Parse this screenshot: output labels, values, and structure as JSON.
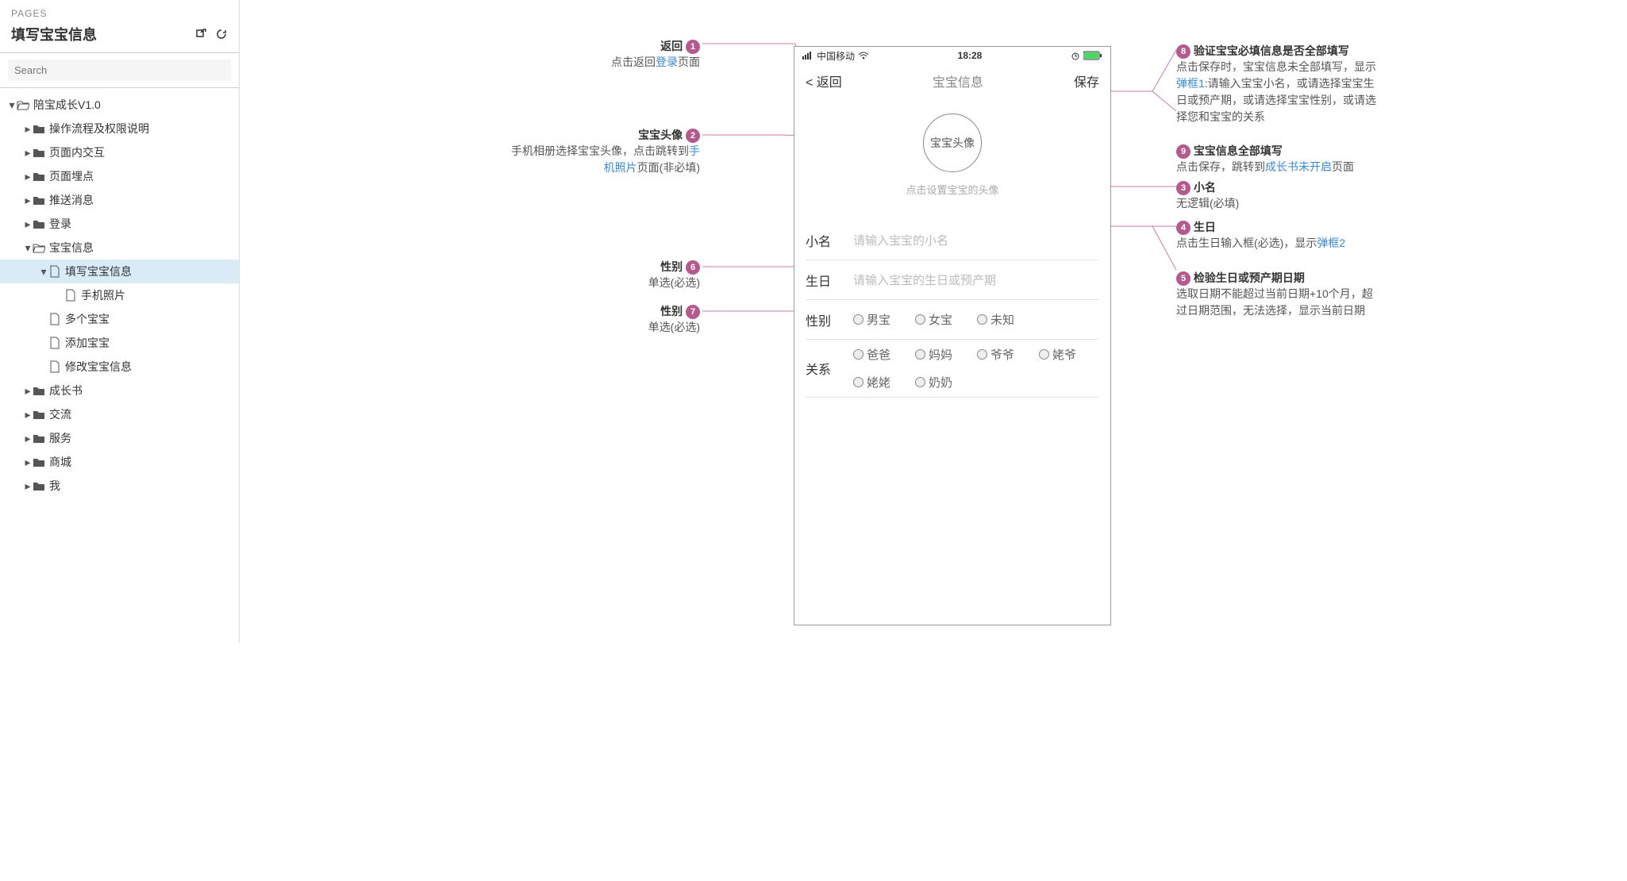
{
  "sidebar": {
    "section_label": "PAGES",
    "title": "填写宝宝信息",
    "search_placeholder": "Search",
    "tree": [
      {
        "label": "陪宝成长V1.0",
        "depth": 0,
        "icon": "folder-open",
        "arrow": "down"
      },
      {
        "label": "操作流程及权限说明",
        "depth": 1,
        "icon": "folder",
        "arrow": "right"
      },
      {
        "label": "页面内交互",
        "depth": 1,
        "icon": "folder",
        "arrow": "right"
      },
      {
        "label": "页面埋点",
        "depth": 1,
        "icon": "folder",
        "arrow": "right"
      },
      {
        "label": "推送消息",
        "depth": 1,
        "icon": "folder",
        "arrow": "right"
      },
      {
        "label": "登录",
        "depth": 1,
        "icon": "folder",
        "arrow": "right"
      },
      {
        "label": "宝宝信息",
        "depth": 1,
        "icon": "folder-open",
        "arrow": "down"
      },
      {
        "label": "填写宝宝信息",
        "depth": 2,
        "icon": "page",
        "arrow": "down",
        "active": true
      },
      {
        "label": "手机照片",
        "depth": 3,
        "icon": "page",
        "arrow": ""
      },
      {
        "label": "多个宝宝",
        "depth": 2,
        "icon": "page",
        "arrow": ""
      },
      {
        "label": "添加宝宝",
        "depth": 2,
        "icon": "page",
        "arrow": ""
      },
      {
        "label": "修改宝宝信息",
        "depth": 2,
        "icon": "page",
        "arrow": ""
      },
      {
        "label": "成长书",
        "depth": 1,
        "icon": "folder",
        "arrow": "right"
      },
      {
        "label": "交流",
        "depth": 1,
        "icon": "folder",
        "arrow": "right"
      },
      {
        "label": "服务",
        "depth": 1,
        "icon": "folder",
        "arrow": "right"
      },
      {
        "label": "商城",
        "depth": 1,
        "icon": "folder",
        "arrow": "right"
      },
      {
        "label": "我",
        "depth": 1,
        "icon": "folder",
        "arrow": "right"
      }
    ]
  },
  "phone": {
    "status": {
      "carrier": "中国移动",
      "time": "18:28"
    },
    "nav": {
      "back": "< 返回",
      "title": "宝宝信息",
      "save": "保存"
    },
    "avatar": {
      "circle_text": "宝宝头像",
      "hint": "点击设置宝宝的头像"
    },
    "rows": {
      "nickname": {
        "label": "小名",
        "placeholder": "请输入宝宝的小名"
      },
      "birthday": {
        "label": "生日",
        "placeholder": "请输入宝宝的生日或预产期"
      },
      "gender": {
        "label": "性别",
        "options": [
          "男宝",
          "女宝",
          "未知"
        ]
      },
      "relation": {
        "label": "关系",
        "options": [
          "爸爸",
          "妈妈",
          "爷爷",
          "姥爷",
          "姥姥",
          "奶奶"
        ]
      }
    }
  },
  "annos": {
    "a1": {
      "num": "1",
      "head": "返回",
      "desc_pre": "点击返回",
      "link": "登录",
      "desc_post": "页面"
    },
    "a2": {
      "num": "2",
      "head": "宝宝头像",
      "desc_pre": "手机相册选择宝宝头像，点击跳转到",
      "link": "手机照片",
      "desc_post": "页面(非必填)"
    },
    "a6": {
      "num": "6",
      "head": "性别",
      "desc": "单选(必选)"
    },
    "a7": {
      "num": "7",
      "head": "性别",
      "desc": "单选(必选)"
    },
    "a8": {
      "num": "8",
      "head": "验证宝宝必填信息是否全部填写",
      "desc_pre": "点击保存时，宝宝信息未全部填写，显示",
      "link": "弹框1",
      "desc_post": ":请输入宝宝小名，或请选择宝宝生日或预产期，或请选择宝宝性别，或请选择您和宝宝的关系"
    },
    "a9": {
      "num": "9",
      "head": "宝宝信息全部填写",
      "desc_pre": "点击保存，跳转到",
      "link": "成长书未开启",
      "desc_post": "页面"
    },
    "a3": {
      "num": "3",
      "head": "小名",
      "desc": "无逻辑(必填)"
    },
    "a4": {
      "num": "4",
      "head": "生日",
      "desc_pre": "点击生日输入框(必选)，显示",
      "link": "弹框2",
      "desc_post": ""
    },
    "a5": {
      "num": "5",
      "head": "检验生日或预产期日期",
      "desc": "选取日期不能超过当前日期+10个月，超过日期范围，无法选择，显示当前日期"
    }
  }
}
